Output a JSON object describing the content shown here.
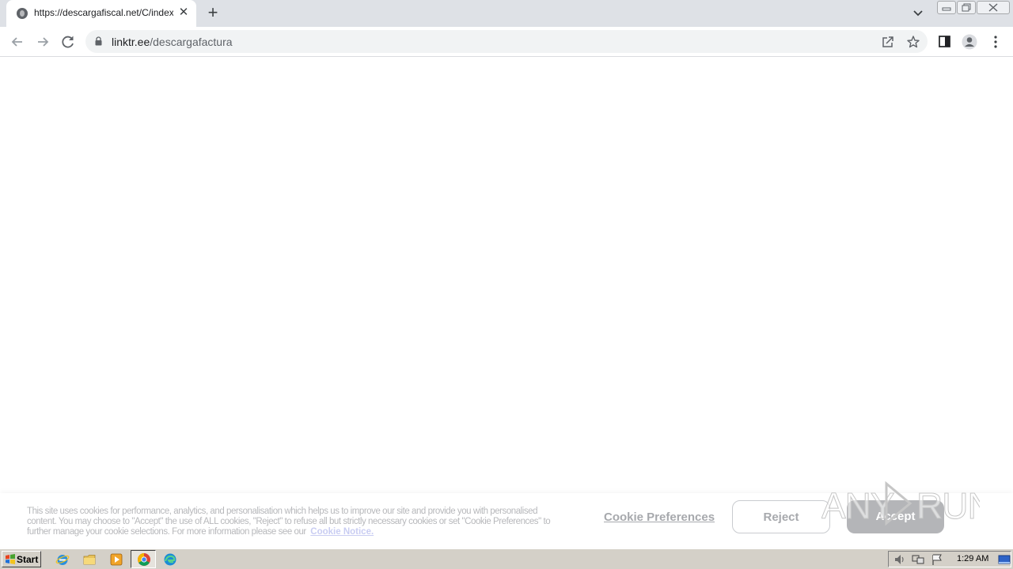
{
  "browser": {
    "tab": {
      "title": "https://descargafiscal.net/C/index.php",
      "favicon": "globe-icon",
      "close_glyph": "✕"
    },
    "new_tab_glyph": "+",
    "address": {
      "host": "linktr.ee",
      "path": "/descargafactura"
    }
  },
  "cookie_banner": {
    "text": "This site uses cookies for performance, analytics, and personalisation which helps us to improve our site and provide you with personalised content. You may choose to \"Accept\" the use of ALL cookies, \"Reject\" to refuse all but strictly necessary cookies or set \"Cookie Preferences\" to further manage your cookie selections. For more information please see our",
    "link": "Cookie Notice.",
    "preferences": "Cookie Preferences",
    "reject": "Reject",
    "accept": "Accept",
    "link_color": "#c9cdf2",
    "accept_bg": "#b4b5b8"
  },
  "watermark": "ANY RUN",
  "taskbar": {
    "start": "Start",
    "quick_launch": [
      "internet-explorer-icon",
      "folder-icon",
      "media-player-icon",
      "chrome-icon",
      "edge-icon"
    ],
    "clock": "1:29 AM"
  }
}
